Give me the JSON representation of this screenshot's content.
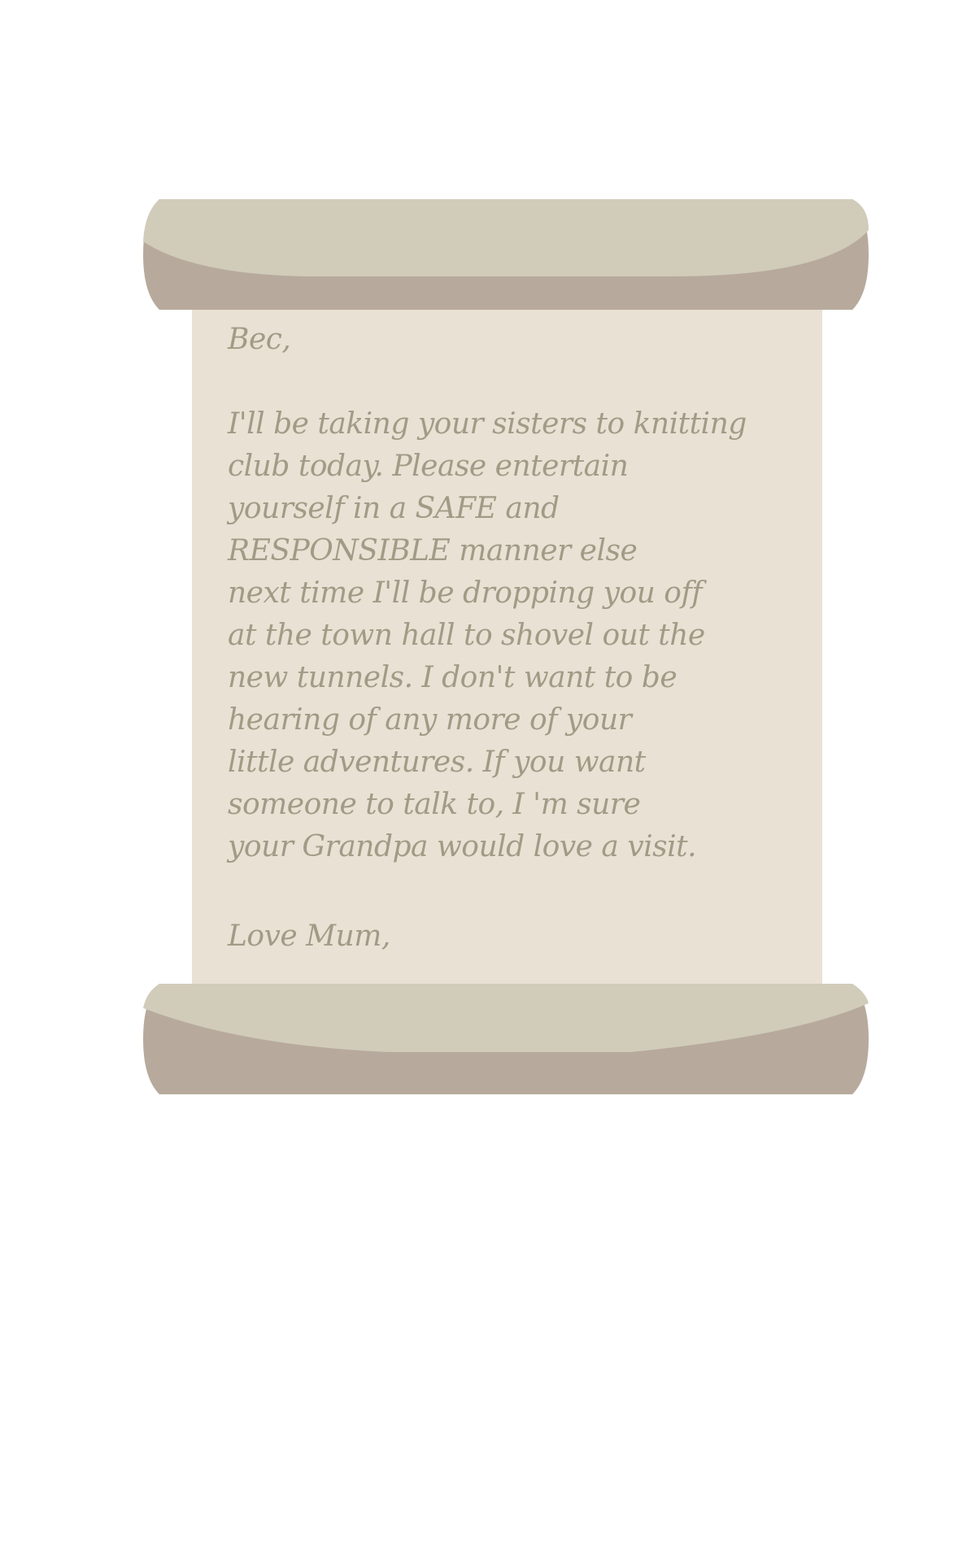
{
  "letter": {
    "greeting": "Bec,",
    "body_lines": [
      "I'll be taking your sisters to knitting",
      "club today. Please entertain",
      "yourself in a SAFE and",
      "RESPONSIBLE manner else",
      "next time I'll be dropping you off",
      "at the town hall to shovel out the",
      "new tunnels. I don't want to be",
      "hearing of any more of your",
      "little adventures. If you want",
      "someone to talk to, I 'm sure",
      "your Grandpa would love a visit."
    ],
    "signoff": "Love Mum,"
  },
  "colors": {
    "paper": "#e8e1d4",
    "roll_light": "#d1cbba",
    "roll_dark": "#b7aa9d",
    "ink": "#a39a86",
    "background": "#ffffff"
  }
}
